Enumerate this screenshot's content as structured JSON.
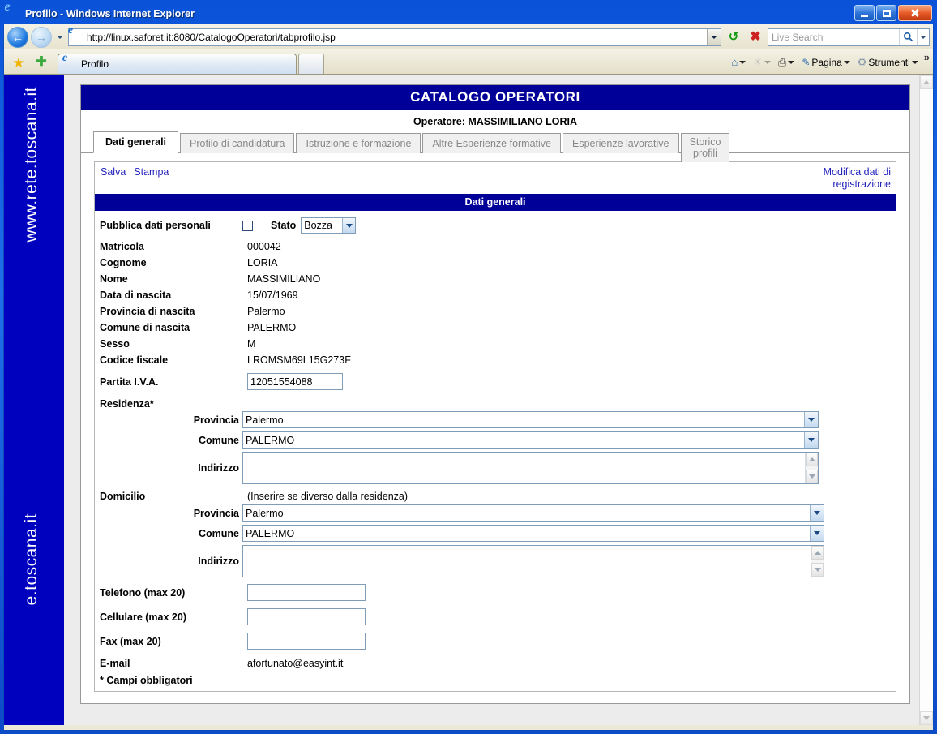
{
  "window": {
    "title": "Profilo - Windows Internet Explorer",
    "icon": "ie-logo-icon",
    "minimize_label": "Minimize",
    "maximize_label": "Maximize",
    "close_label": "Close"
  },
  "browser": {
    "back_label": "Back",
    "forward_label": "Forward",
    "history_label": "Recent Pages",
    "url": "http://linux.saforet.it:8080/CatalogoOperatori/tabprofilo.jsp",
    "refresh_label": "Refresh",
    "stop_label": "Stop",
    "search": {
      "placeholder": "Live Search",
      "value": ""
    },
    "favorites_label": "Preferiti",
    "add_favorites_label": "Aggiungi a Preferiti",
    "tab_label": "Profilo",
    "new_tab_label": "Nuova scheda",
    "toolbar": {
      "home": "Home",
      "feeds": "Feed",
      "print": "Stampa",
      "page": "Pagina",
      "tools": "Strumenti",
      "overflow": "»"
    }
  },
  "sidebar": {
    "text_top": "www.rete.toscana.it",
    "text_bottom": "e.toscana.it"
  },
  "page": {
    "app_title": "CATALOGO OPERATORI",
    "operator_line": "Operatore: MASSIMILIANO LORIA",
    "tabs": [
      {
        "label": "Dati generali",
        "active": true
      },
      {
        "label": "Profilo di candidatura",
        "active": false
      },
      {
        "label": "Istruzione e formazione",
        "active": false
      },
      {
        "label": "Altre Esperienze formative",
        "active": false
      },
      {
        "label": "Esperienze lavorative",
        "active": false
      },
      {
        "label": "Storico profili",
        "active": false,
        "line1": "Storico",
        "line2": "profili"
      }
    ],
    "actions": {
      "save": "Salva",
      "print": "Stampa",
      "edit_registration_line1": "Modifica dati di",
      "edit_registration_line2": "registrazione"
    },
    "section_title": "Dati generali",
    "publish": {
      "label": "Pubblica dati personali",
      "checked": false,
      "stato_label": "Stato",
      "stato_value": "Bozza"
    },
    "fields": [
      {
        "label": "Matricola",
        "value": "000042"
      },
      {
        "label": "Cognome",
        "value": "LORIA"
      },
      {
        "label": "Nome",
        "value": "MASSIMILIANO"
      },
      {
        "label": "Data di nascita",
        "value": "15/07/1969"
      },
      {
        "label": "Provincia di nascita",
        "value": "Palermo"
      },
      {
        "label": "Comune di nascita",
        "value": "PALERMO"
      },
      {
        "label": "Sesso",
        "value": "M"
      },
      {
        "label": "Codice fiscale",
        "value": "LROMSM69L15G273F"
      }
    ],
    "partita_iva": {
      "label": "Partita I.V.A.",
      "value": "12051554088"
    },
    "residenza": {
      "label": "Residenza*",
      "provincia_label": "Provincia",
      "provincia_value": "Palermo",
      "comune_label": "Comune",
      "comune_value": "PALERMO",
      "indirizzo_label": "Indirizzo",
      "indirizzo_value": ""
    },
    "domicilio": {
      "label": "Domicilio",
      "hint": "(Inserire se diverso dalla residenza)",
      "provincia_label": "Provincia",
      "provincia_value": "Palermo",
      "comune_label": "Comune",
      "comune_value": "PALERMO",
      "indirizzo_label": "Indirizzo",
      "indirizzo_value": ""
    },
    "contacts": [
      {
        "label": "Telefono (max 20)",
        "value": ""
      },
      {
        "label": "Cellulare (max 20)",
        "value": ""
      },
      {
        "label": "Fax (max 20)",
        "value": ""
      }
    ],
    "email": {
      "label": "E-mail",
      "value": "afortunato@easyint.it"
    },
    "required_note": "* Campi obbligatori"
  },
  "colors": {
    "brand_blue": "#000099",
    "sidebar_blue": "#0000bf",
    "link_blue": "#2222bb",
    "titlebar_blue": "#0a52d8"
  }
}
